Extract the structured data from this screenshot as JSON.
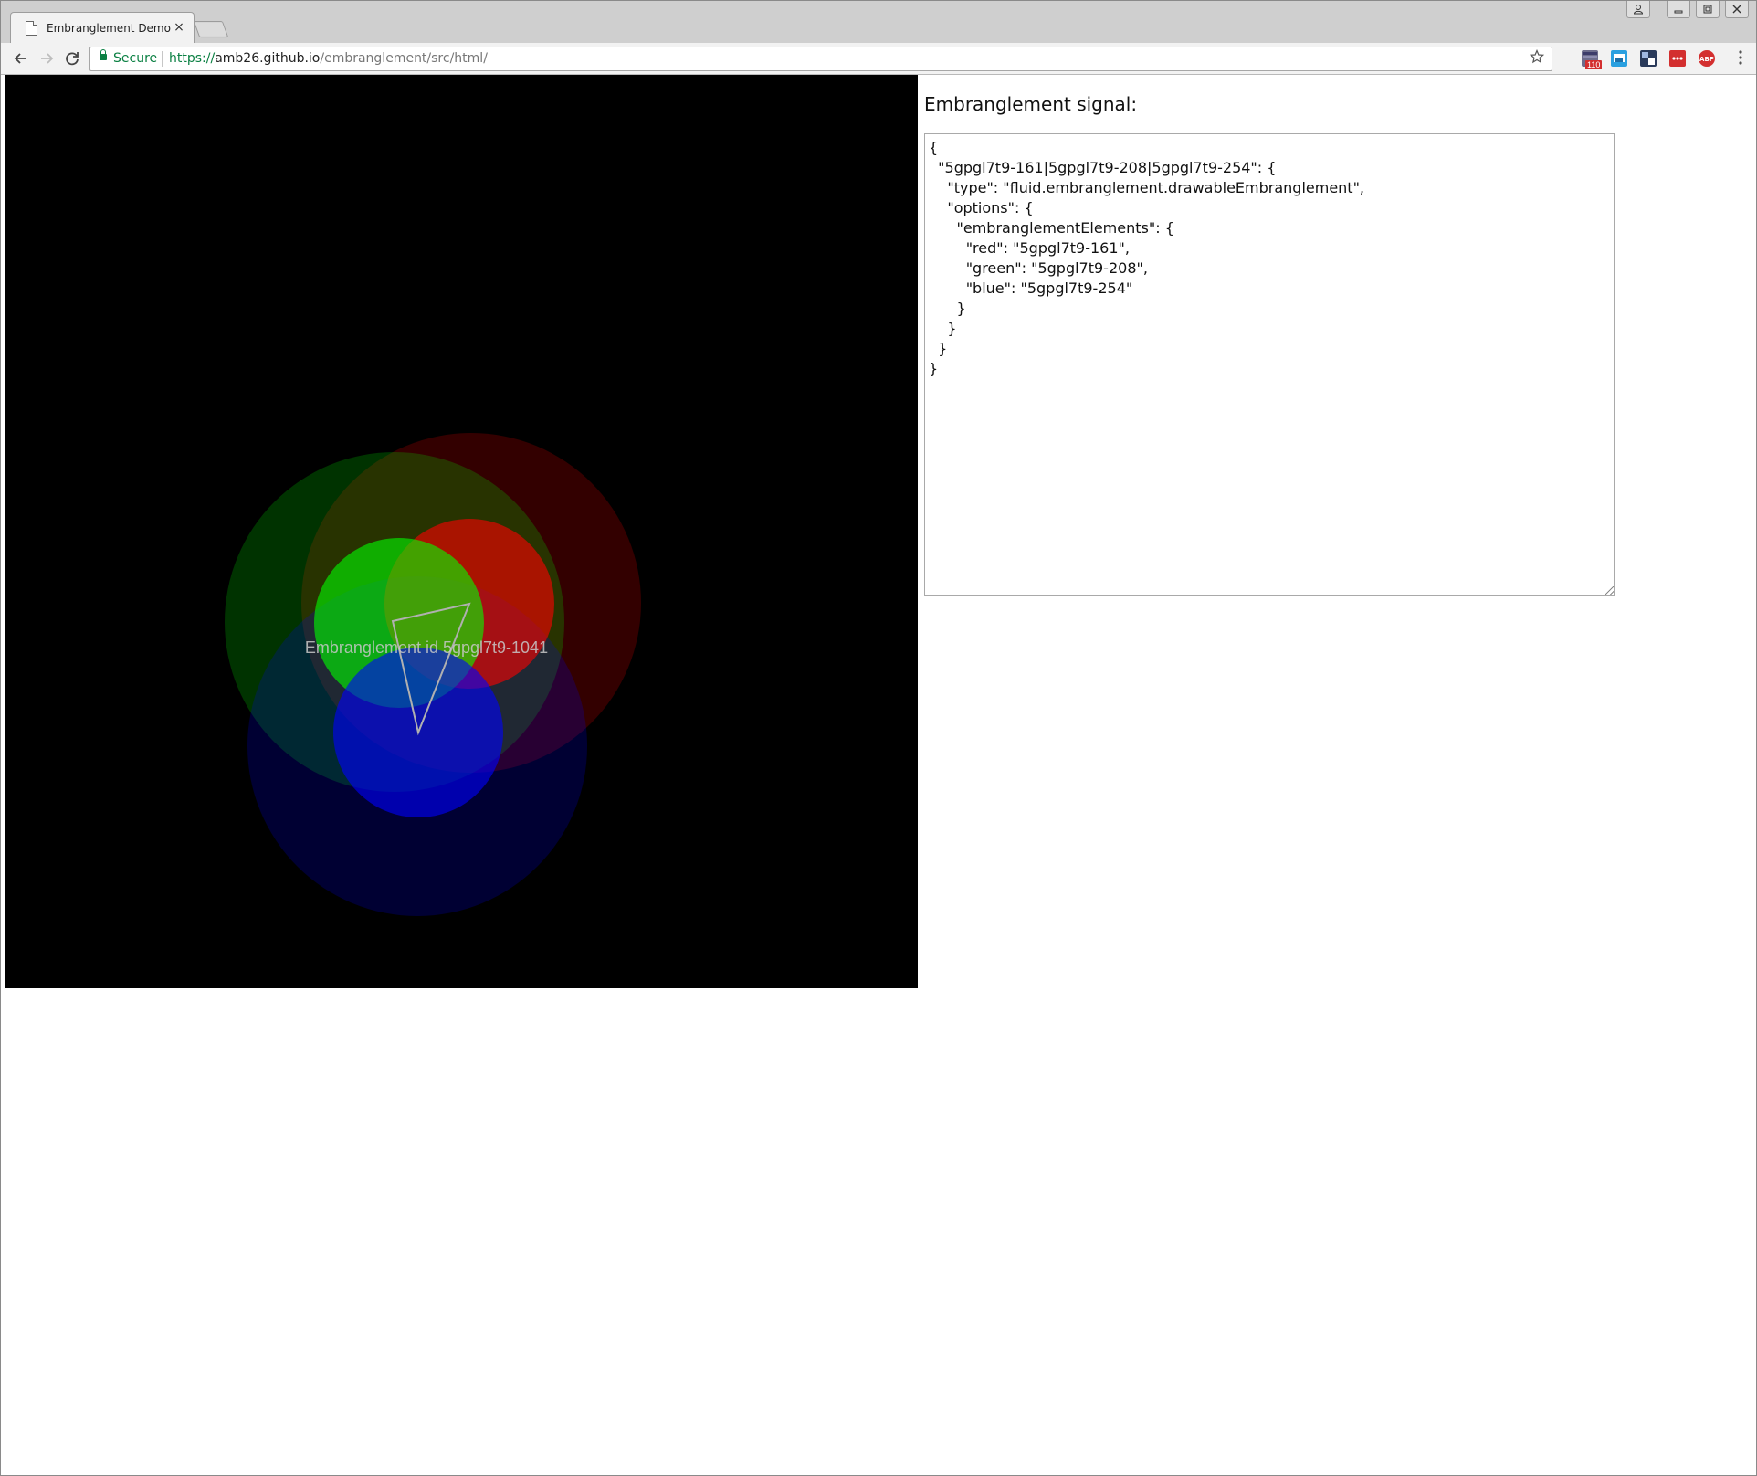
{
  "browser": {
    "tab_title": "Embranglement Demo",
    "tab_close_glyph": "×",
    "secure_label": "Secure",
    "url_scheme": "https://",
    "url_host": "amb26.github.io",
    "url_path": "/embranglement/src/html/",
    "extension_badge": "110",
    "icons": {
      "back": "back-arrow-icon",
      "forward": "forward-arrow-icon",
      "reload": "reload-icon",
      "bookmark": "star-icon",
      "menu": "kebab-menu-icon"
    }
  },
  "canvas": {
    "background": "#000000",
    "label": "Embranglement id 5gpgl7t9-1041",
    "circles": {
      "outer": [
        {
          "color": "#ff0000",
          "opacity": 0.2
        },
        {
          "color": "#00ff00",
          "opacity": 0.2
        },
        {
          "color": "#0000ff",
          "opacity": 0.2
        }
      ],
      "inner": [
        {
          "color": "#ff0000",
          "opacity": 0.6
        },
        {
          "color": "#00ff00",
          "opacity": 0.6
        },
        {
          "color": "#0000ff",
          "opacity": 0.6
        }
      ]
    }
  },
  "signal": {
    "heading": "Embranglement signal:",
    "json_text": "{\n  \"5gpgl7t9-161|5gpgl7t9-208|5gpgl7t9-254\": {\n    \"type\": \"fluid.embranglement.drawableEmbranglement\",\n    \"options\": {\n      \"embranglementElements\": {\n        \"red\": \"5gpgl7t9-161\",\n        \"green\": \"5gpgl7t9-208\",\n        \"blue\": \"5gpgl7t9-254\"\n      }\n    }\n  }\n}"
  }
}
